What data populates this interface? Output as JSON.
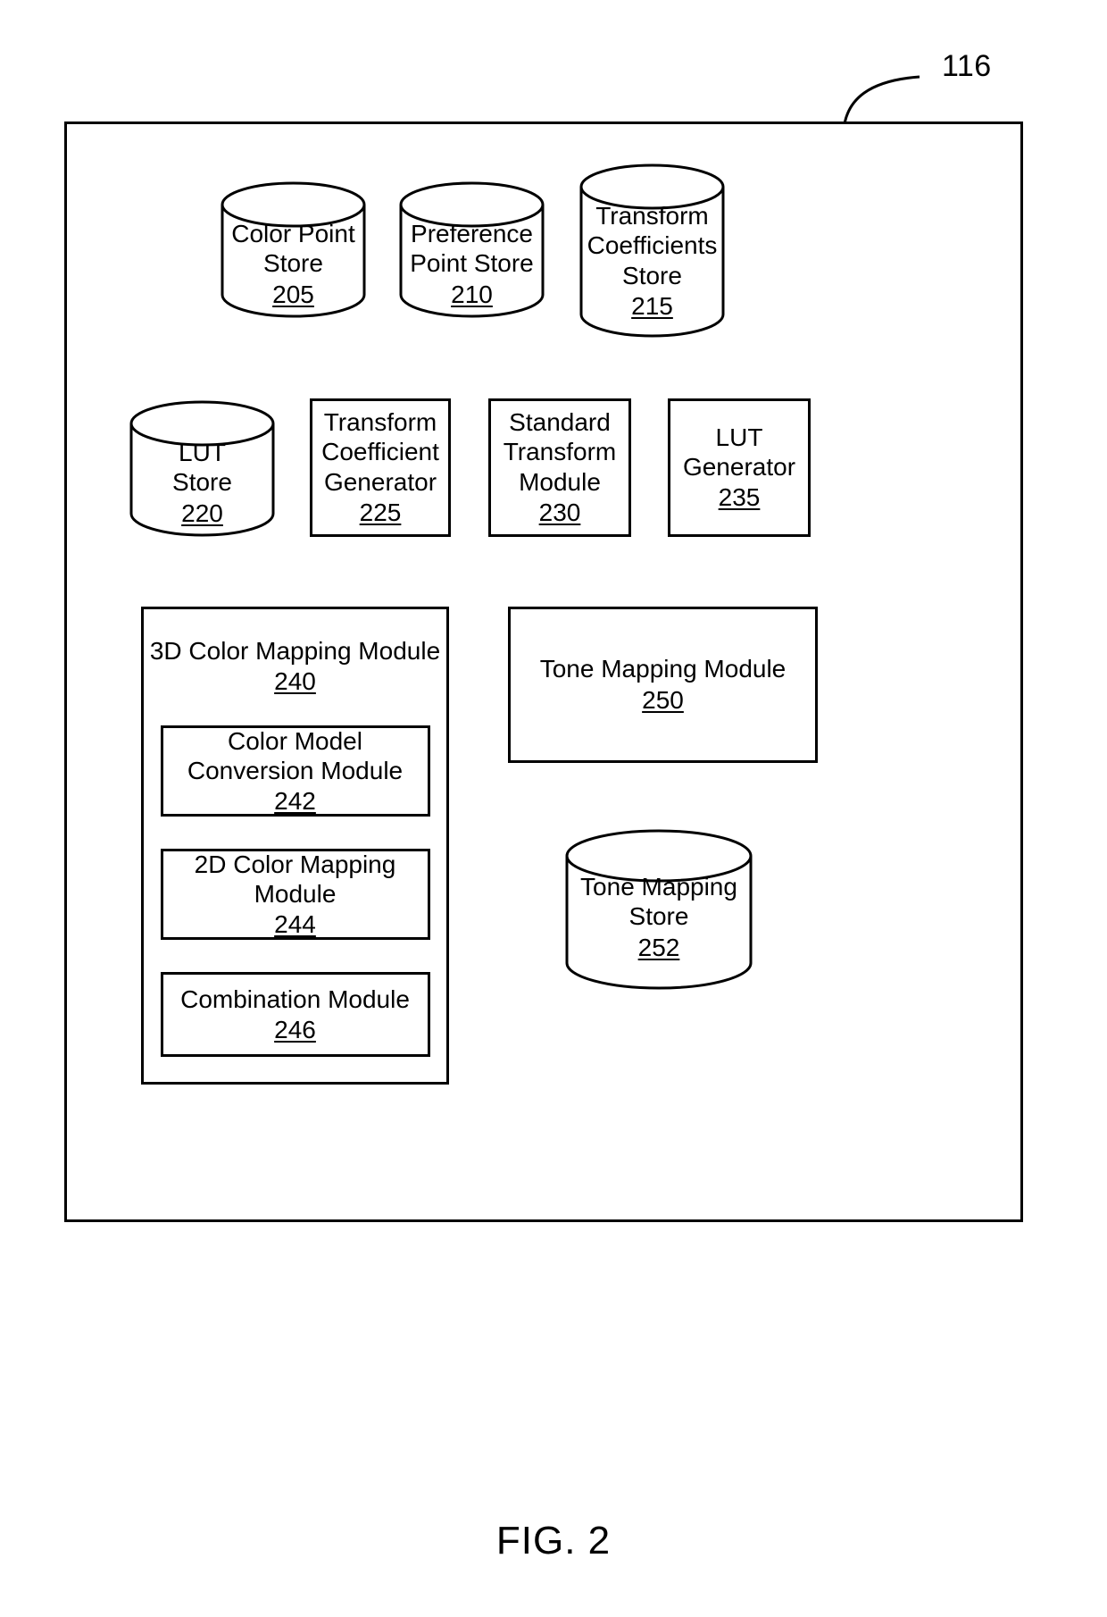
{
  "figure": {
    "caption": "FIG. 2",
    "system_callout": "116"
  },
  "nodes": {
    "color_point_store": {
      "label": "Color Point\nStore",
      "ref": "205",
      "shape": "cylinder"
    },
    "preference_point_store": {
      "label": "Preference\nPoint Store",
      "ref": "210",
      "shape": "cylinder"
    },
    "transform_coefficients_store": {
      "label": "Transform\nCoefficients\nStore",
      "ref": "215",
      "shape": "cylinder"
    },
    "lut_store": {
      "label": "LUT\nStore",
      "ref": "220",
      "shape": "cylinder"
    },
    "transform_coefficient_generator": {
      "label": "Transform\nCoefficient\nGenerator",
      "ref": "225",
      "shape": "rect"
    },
    "standard_transform_module": {
      "label": "Standard\nTransform\nModule",
      "ref": "230",
      "shape": "rect"
    },
    "lut_generator": {
      "label": "LUT\nGenerator",
      "ref": "235",
      "shape": "rect"
    },
    "three_d_color_mapping_module": {
      "label": "3D Color Mapping Module",
      "ref": "240",
      "shape": "rect"
    },
    "color_model_conversion_module": {
      "label": "Color Model\nConversion Module",
      "ref": "242",
      "shape": "rect"
    },
    "two_d_color_mapping_module": {
      "label": "2D Color Mapping\nModule",
      "ref": "244",
      "shape": "rect"
    },
    "combination_module": {
      "label": "Combination Module",
      "ref": "246",
      "shape": "rect"
    },
    "tone_mapping_module": {
      "label": "Tone Mapping Module",
      "ref": "250",
      "shape": "rect"
    },
    "tone_mapping_store": {
      "label": "Tone Mapping\nStore",
      "ref": "252",
      "shape": "cylinder"
    }
  },
  "style": {
    "stroke": "#000000",
    "background": "#ffffff"
  }
}
